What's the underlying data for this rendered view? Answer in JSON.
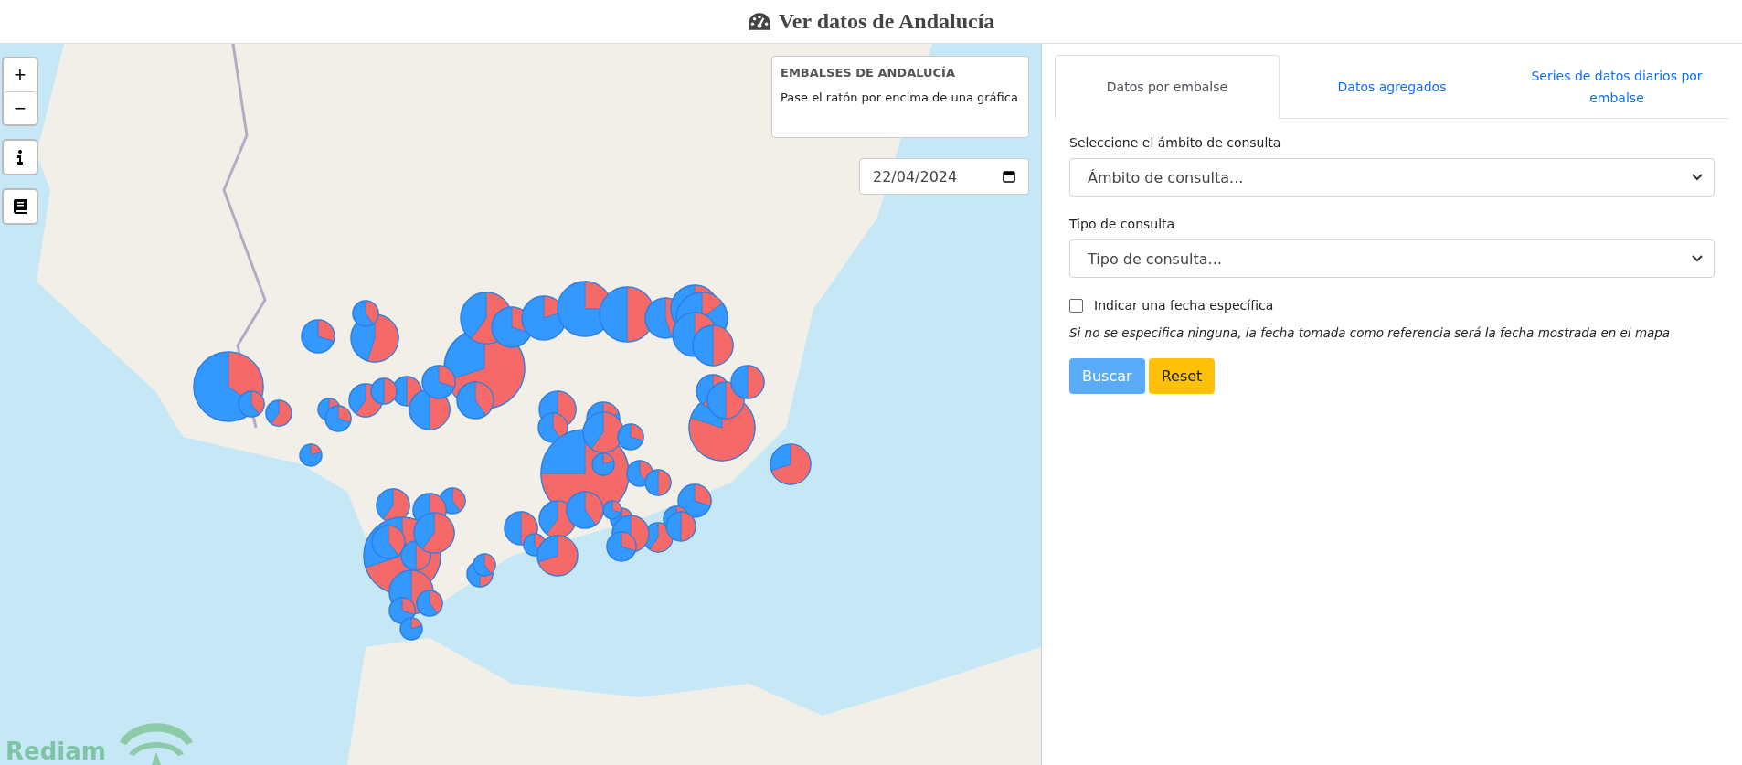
{
  "header": {
    "title": "Ver datos de Andalucía"
  },
  "map": {
    "zoom_controls": [
      {
        "label": "+"
      },
      {
        "label": "−"
      }
    ],
    "legend": {
      "title": "EMBALSES DE ANDALUCÍA",
      "text": "Pase el ratón por encima de una gráfica"
    },
    "date_field": {
      "value": "22/04/2024"
    },
    "logo": {
      "text": "Rediam"
    }
  },
  "panel": {
    "tabs": [
      {
        "label": "Datos por embalse",
        "selected": true
      },
      {
        "label": "Datos agregados",
        "selected": false
      },
      {
        "label": "Series de datos diarios por embalse",
        "selected": false
      }
    ],
    "fields": [
      {
        "label": "Seleccione el ámbito de consulta",
        "value": "Ámbito de consulta..."
      },
      {
        "label": "Tipo de consulta",
        "value": "Tipo de consulta..."
      }
    ],
    "checkbox": {
      "label": "Indicar una fecha específica",
      "checked": false
    },
    "note": "Si no se especifica ninguna, la fecha tomada como referencia será la fecha mostrada en el mapa",
    "buttons": [
      {
        "label": "Buscar",
        "kind": "primary"
      },
      {
        "label": "Reset",
        "kind": "warning"
      }
    ]
  }
}
